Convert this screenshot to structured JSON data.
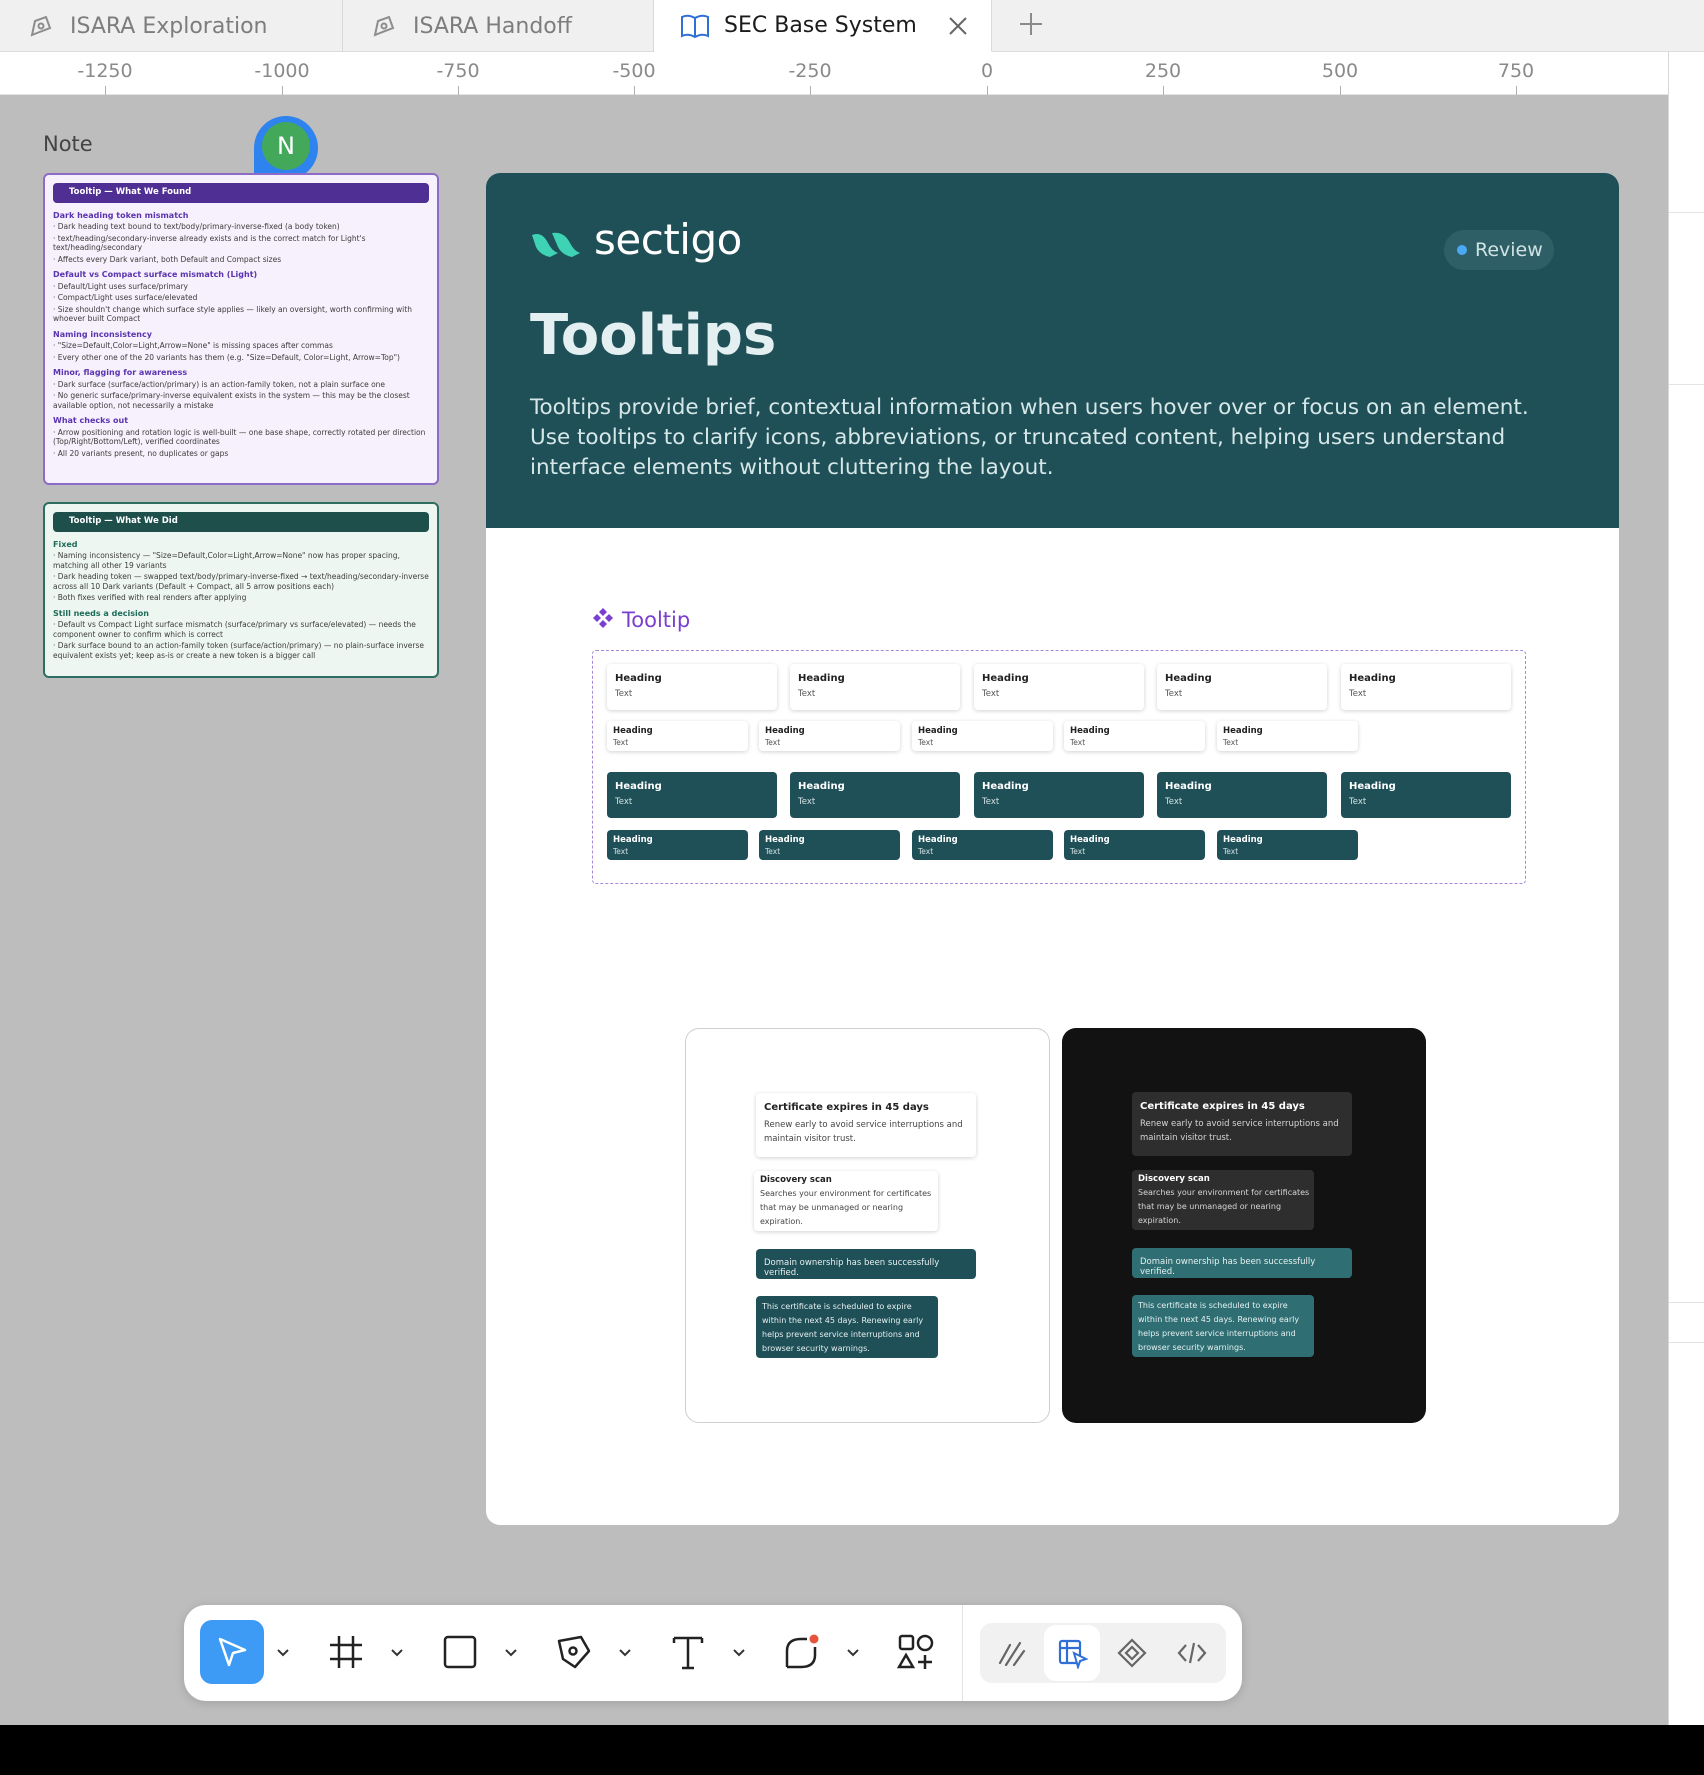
{
  "tabs": [
    {
      "label": "ISARA Exploration",
      "icon": "pen-nib-icon"
    },
    {
      "label": "ISARA Handoff",
      "icon": "pen-nib-icon"
    },
    {
      "label": "SEC Base System",
      "icon": "book-icon",
      "active": true
    }
  ],
  "ruler": {
    "ticks": [
      "-1250",
      "-1000",
      "-750",
      "-500",
      "-250",
      "0",
      "250",
      "500",
      "750"
    ]
  },
  "note_label": "Note",
  "avatar_initial": "N",
  "note_found": {
    "title": "Tooltip — What We Found",
    "sections": [
      {
        "heading": "Dark heading token mismatch",
        "lines": [
          "· Dark heading text bound to text/body/primary-inverse-fixed (a body token)",
          "· text/heading/secondary-inverse already exists and is the correct match for Light's text/heading/secondary",
          "· Affects every Dark variant, both Default and Compact sizes"
        ]
      },
      {
        "heading": "Default vs Compact surface mismatch (Light)",
        "lines": [
          "· Default/Light uses surface/primary",
          "· Compact/Light uses surface/elevated",
          "· Size shouldn't change which surface style applies — likely an oversight, worth confirming with whoever built Compact"
        ]
      },
      {
        "heading": "Naming inconsistency",
        "lines": [
          "· \"Size=Default,Color=Light,Arrow=None\" is missing spaces after commas",
          "· Every other one of the 20 variants has them (e.g. \"Size=Default, Color=Light, Arrow=Top\")"
        ]
      },
      {
        "heading": "Minor, flagging for awareness",
        "lines": [
          "· Dark surface (surface/action/primary) is an action-family token, not a plain surface one",
          "· No generic surface/primary-inverse equivalent exists in the system — this may be the closest available option, not necessarily a mistake"
        ]
      },
      {
        "heading": "What checks out",
        "lines": [
          "· Arrow positioning and rotation logic is well-built — one base shape, correctly rotated per direction (Top/Right/Bottom/Left), verified coordinates",
          "· All 20 variants present, no duplicates or gaps"
        ]
      }
    ]
  },
  "note_did": {
    "title": "Tooltip — What We Did",
    "sections": [
      {
        "heading": "Fixed",
        "lines": [
          "· Naming inconsistency — \"Size=Default,Color=Light,Arrow=None\" now has proper spacing, matching all other 19 variants",
          "· Dark heading token — swapped text/body/primary-inverse-fixed → text/heading/secondary-inverse across all 10 Dark variants (Default + Compact, all 5 arrow positions each)",
          "· Both fixes verified with real renders after applying"
        ]
      },
      {
        "heading": "Still needs a decision",
        "lines": [
          "· Default vs Compact Light surface mismatch (surface/primary vs surface/elevated) — needs the component owner to confirm which is correct",
          "· Dark surface bound to an action-family token (surface/action/primary) — no plain-surface inverse equivalent exists yet; keep as-is or create a new token is a bigger call"
        ]
      }
    ]
  },
  "hero": {
    "brand": "sectigo",
    "badge": "Review",
    "title": "Tooltips",
    "description": "Tooltips provide brief, contextual information when users hover over or focus on an element. Use tooltips to clarify icons, abbreviations, or truncated content, helping users understand interface elements without cluttering the layout."
  },
  "component": {
    "label": "Tooltip",
    "heading": "Heading",
    "text": "Text"
  },
  "examples": {
    "cert_heading": "Certificate expires in 45 days",
    "cert_text": "Renew early to avoid service interruptions and maintain visitor trust.",
    "scan_heading": "Discovery scan",
    "scan_text": "Searches your environment for certificates that may be unmanaged or nearing expiration.",
    "domain_text": "Domain ownership has been successfully verified.",
    "schedule_text": "This certificate is scheduled to expire within the next 45 days. Renewing early helps prevent service interruptions and browser security warnings."
  },
  "colors": {
    "hero_bg": "#1f4f57",
    "brand_accent": "#3fd3b6",
    "component_purple": "#7b3fd0",
    "select_blue": "#4aa8f5"
  },
  "toolbar": {
    "tools": [
      "move-tool",
      "frame-tool",
      "rectangle-tool",
      "pen-tool",
      "text-tool",
      "shape-tool",
      "components-tool",
      "draw-tool",
      "dev-annotate-tool",
      "components-diamond-tool",
      "code-tool"
    ]
  }
}
